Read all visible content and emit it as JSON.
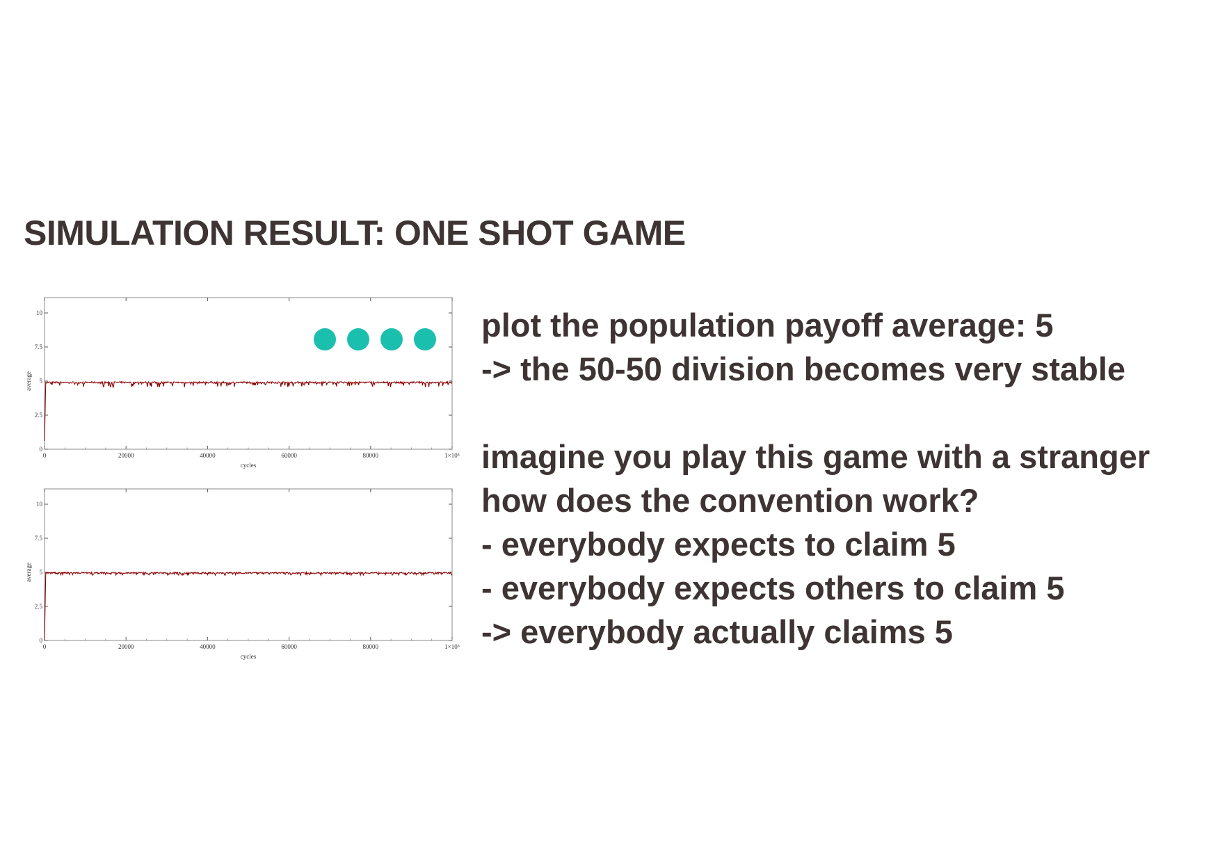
{
  "title": "SIMULATION RESULT: ONE SHOT GAME",
  "text_lines": [
    "plot the population payoff average: 5",
    "-> the 50-50 division becomes very stable",
    "",
    "imagine you play this game with a stranger",
    "how does the convention work?",
    "- everybody expects to claim 5",
    "- everybody expects others to claim 5",
    "-> everybody actually claims 5"
  ],
  "dot_color": "#1bbfae",
  "dots": 4,
  "chart_data": [
    {
      "type": "line",
      "xlabel": "cycles",
      "ylabel": "average",
      "xlim": [
        0,
        100000
      ],
      "ylim": [
        0,
        10
      ],
      "x_ticks": [
        "0",
        "20000",
        "40000",
        "60000",
        "80000",
        "1×10⁵"
      ],
      "y_ticks": [
        "0",
        "2.5",
        "5",
        "7.5",
        "10"
      ],
      "series": [
        {
          "color": "#8b0000",
          "initial_value": 0.6,
          "steady_value": 4.9,
          "noise_low": 4.55,
          "noise_high": 4.97
        }
      ],
      "grid": false
    },
    {
      "type": "line",
      "xlabel": "cycles",
      "ylabel": "average",
      "xlim": [
        0,
        100000
      ],
      "ylim": [
        0,
        10
      ],
      "x_ticks": [
        "0",
        "20000",
        "40000",
        "60000",
        "80000",
        "1×10⁵"
      ],
      "y_ticks": [
        "0",
        "2.5",
        "5",
        "7.5",
        "10"
      ],
      "series": [
        {
          "color": "#8b0000",
          "initial_value": 0.0,
          "steady_value": 4.96,
          "noise_low": 4.78,
          "noise_high": 5.0
        }
      ],
      "grid": false
    }
  ]
}
